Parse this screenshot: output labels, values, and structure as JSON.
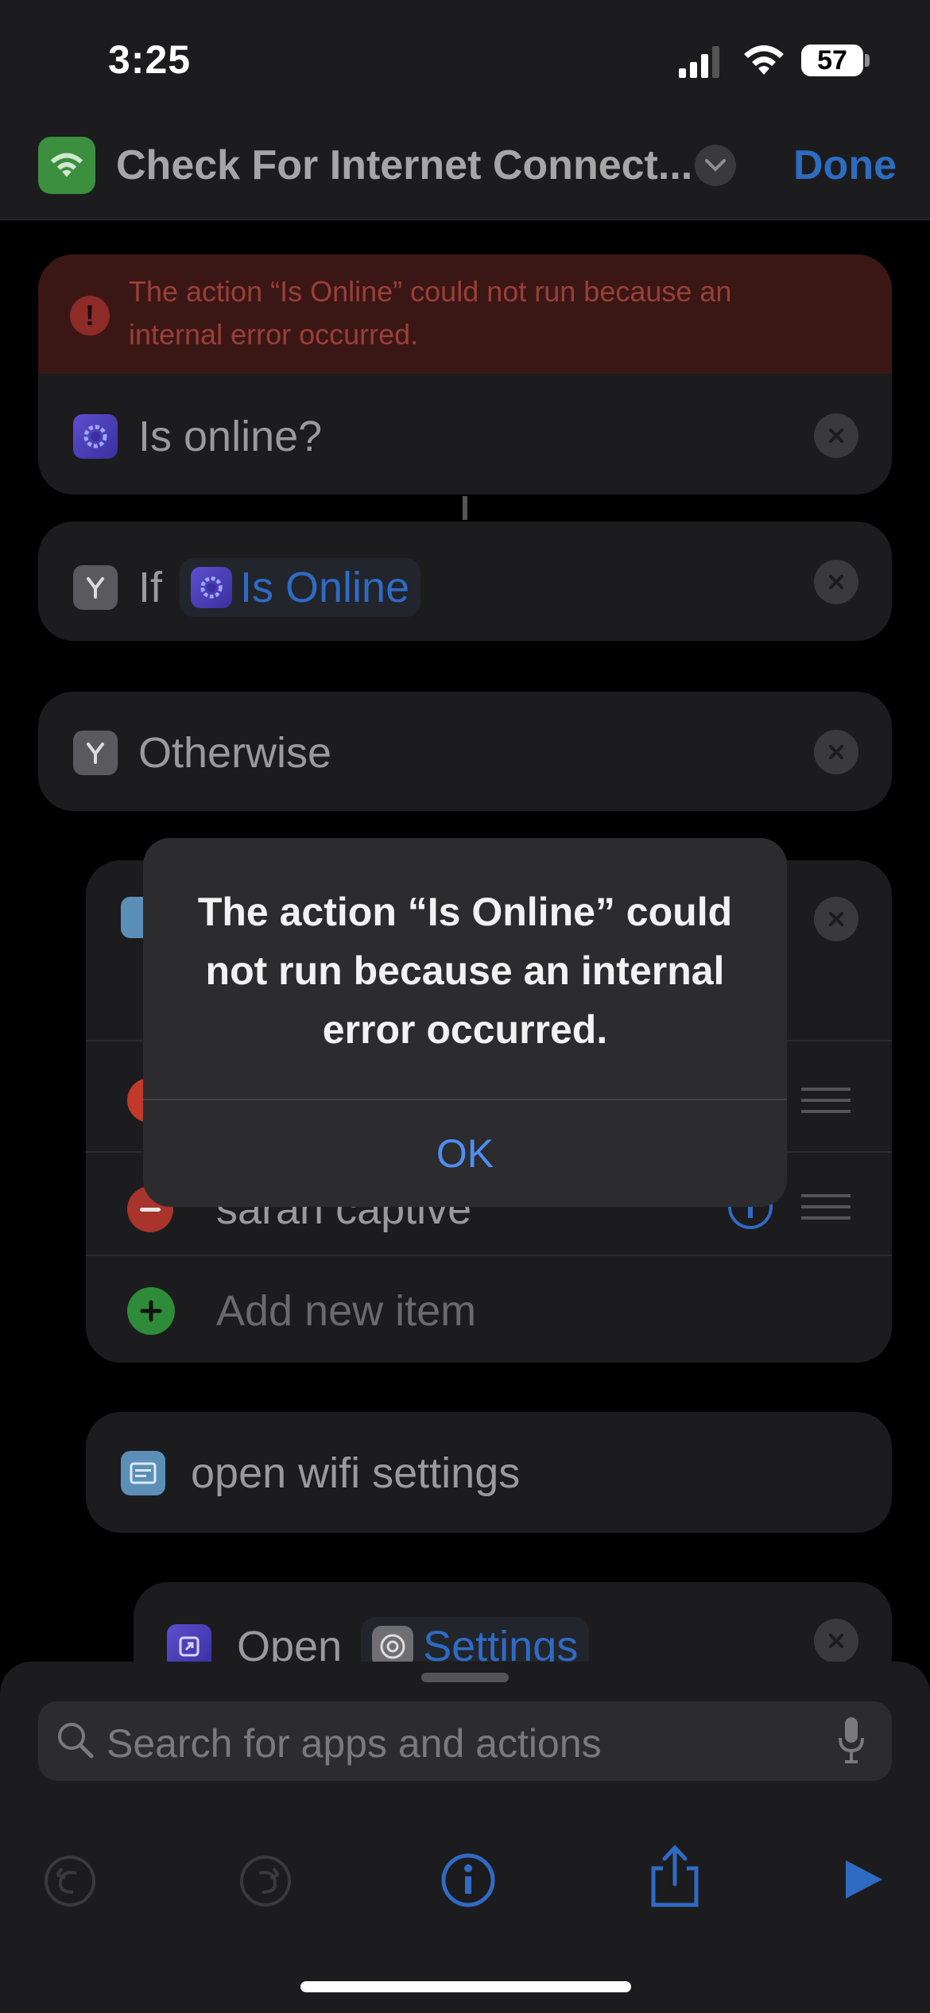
{
  "status_bar": {
    "time": "3:25",
    "battery": "57"
  },
  "nav": {
    "title": "Check For Internet Connect...",
    "done": "Done"
  },
  "error_banner": {
    "text": "The action “Is Online” could not run because an internal error occurred."
  },
  "actions": {
    "is_online": "Is online?",
    "if_label": "If",
    "if_token": "Is Online",
    "otherwise": "Otherwise",
    "list_item_2": "sarah captive",
    "add_new_item": "Add new item",
    "comment": "open wifi settings",
    "open_label": "Open",
    "open_token": "Settings"
  },
  "alert": {
    "message": "The action “Is Online” could not run because an internal error occurred.",
    "ok": "OK"
  },
  "search": {
    "placeholder": "Search for apps and actions"
  },
  "colors": {
    "accent": "#2f6bc4",
    "error": "#9a3f38",
    "alert_ok": "#4f8df5"
  },
  "icons": [
    "wifi-icon",
    "chevron-down-icon",
    "exclamation-icon",
    "gear-icon",
    "branch-icon",
    "close-icon",
    "minus-icon",
    "plus-icon",
    "info-icon",
    "drag-handle-icon",
    "text-icon",
    "open-app-icon",
    "settings-icon",
    "search-icon",
    "mic-icon",
    "undo-icon",
    "redo-icon",
    "share-icon",
    "play-icon"
  ]
}
